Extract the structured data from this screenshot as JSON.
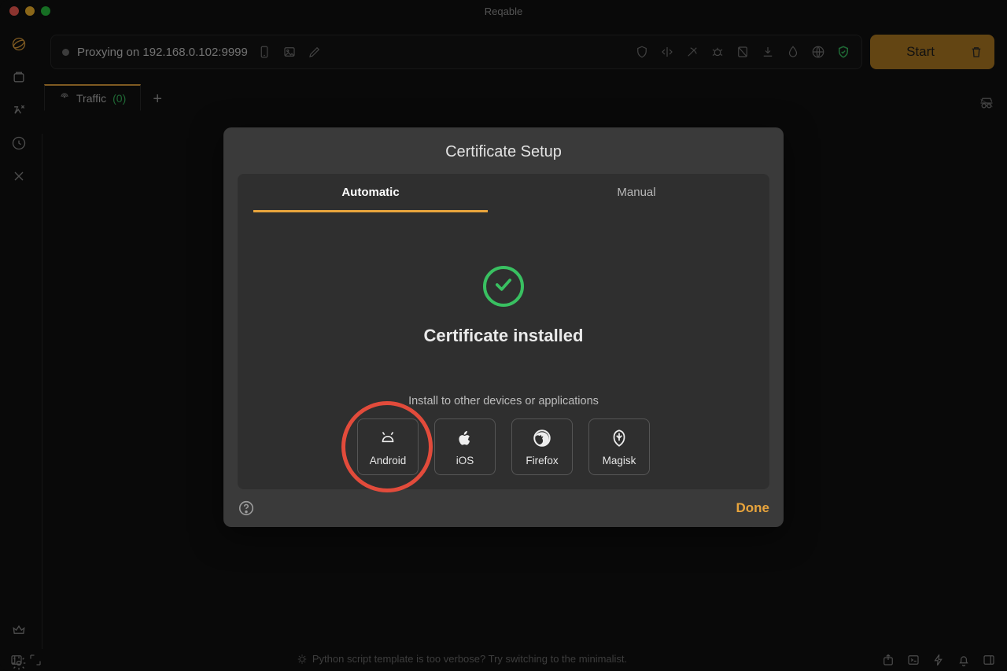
{
  "app": {
    "title": "Reqable"
  },
  "toolbar": {
    "status_text": "Proxying on 192.168.0.102:9999",
    "start_label": "Start"
  },
  "tab": {
    "label": "Traffic",
    "count": "(0)"
  },
  "dialog": {
    "title": "Certificate Setup",
    "tab_auto": "Automatic",
    "tab_manual": "Manual",
    "installed": "Certificate installed",
    "other": "Install to other devices or applications",
    "devices": {
      "android": "Android",
      "ios": "iOS",
      "firefox": "Firefox",
      "magisk": "Magisk"
    },
    "done": "Done"
  },
  "footer": {
    "tip": "Python script template is too verbose? Try switching to the minimalist."
  }
}
